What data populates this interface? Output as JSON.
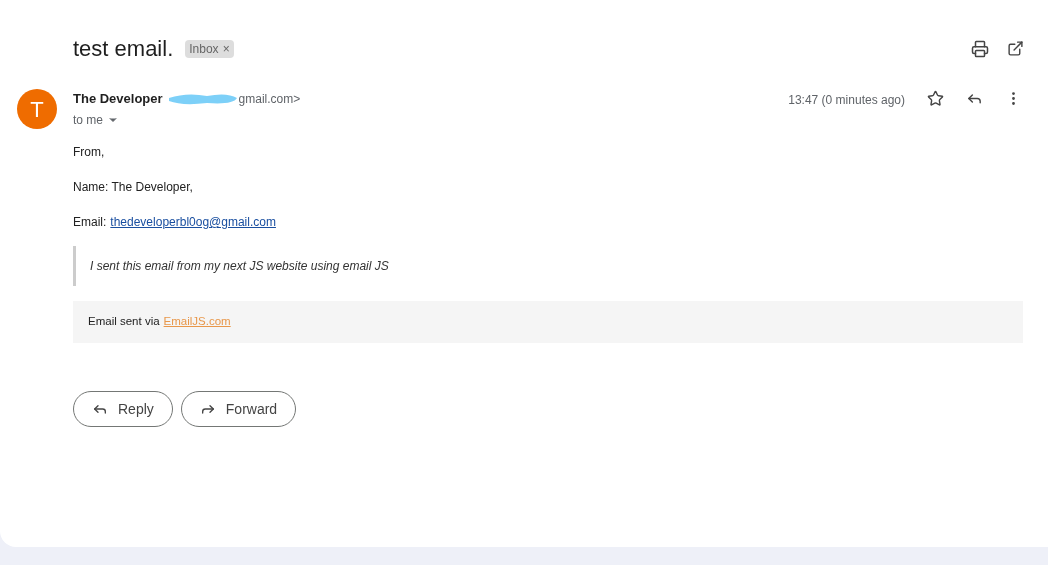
{
  "subject": "test email.",
  "label": {
    "text": "Inbox",
    "remove": "×"
  },
  "sender": {
    "initial": "T",
    "name": "The Developer",
    "address_visible": "gmail.com>",
    "recipient": "to me"
  },
  "time": "13:47 (0 minutes ago)",
  "starred": false,
  "body": {
    "lines": [
      "From,",
      "Name: The Developer,"
    ],
    "email_label": "Email:",
    "email_link": "thedeveloperbl0og@gmail.com",
    "quote": "I sent this email from my next JS website using email JS",
    "footer_text": "Email sent via",
    "footer_link": "EmailJS.com"
  },
  "actions": [
    {
      "kind": "reply",
      "label": "Reply"
    },
    {
      "kind": "forward",
      "label": "Forward"
    }
  ]
}
